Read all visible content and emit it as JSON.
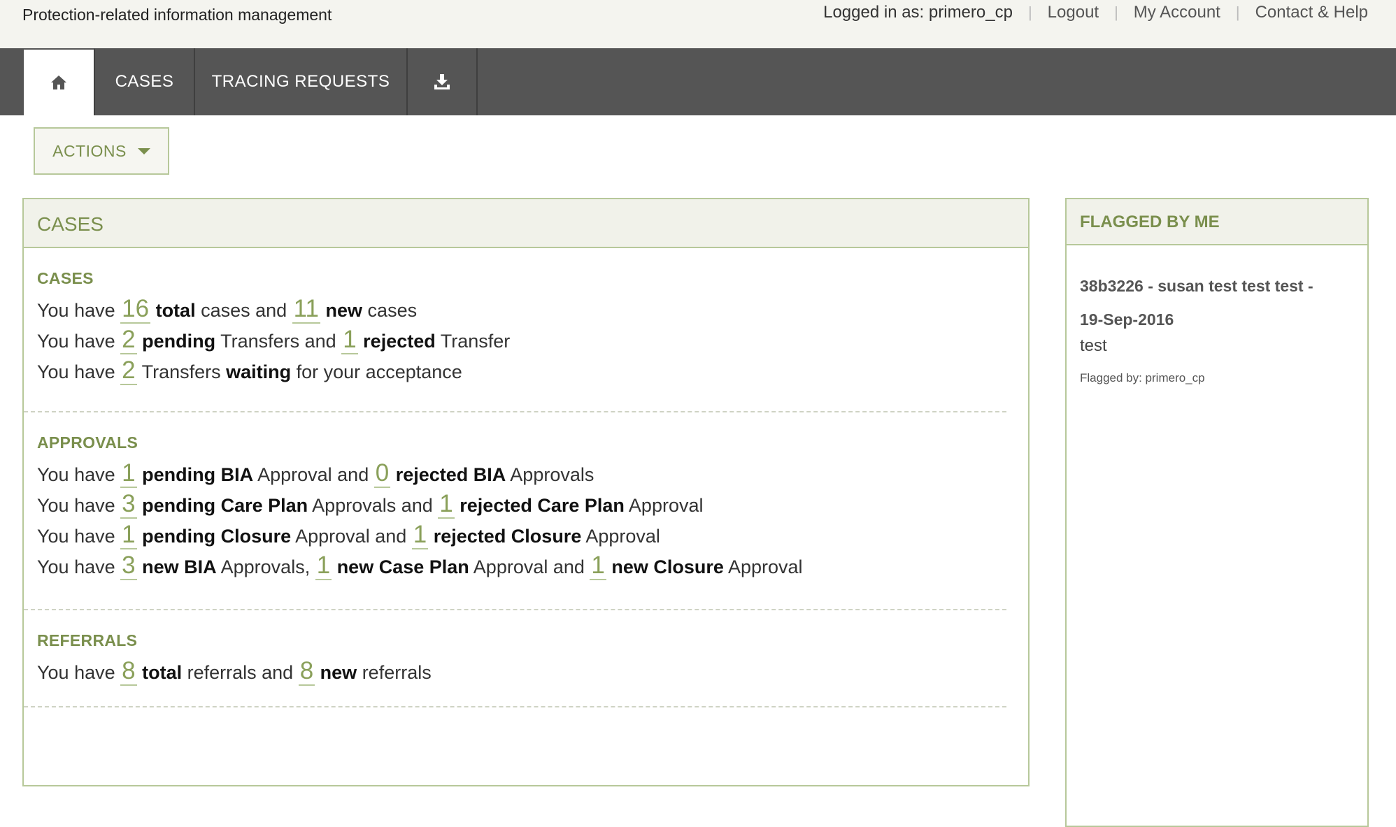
{
  "header": {
    "app_title": "Protection-related information management",
    "logged_in": "Logged in as: primero_cp",
    "logout": "Logout",
    "my_account": "My Account",
    "contact_help": "Contact & Help"
  },
  "nav": {
    "home_icon": "home-icon",
    "cases": "CASES",
    "tracing": "TRACING REQUESTS",
    "export_icon": "download-icon"
  },
  "actions": {
    "label": "ACTIONS"
  },
  "cases_panel": {
    "title": "CASES",
    "cases_section": {
      "title": "CASES",
      "lines": [
        [
          "You have ",
          "16",
          "total",
          " cases and ",
          "11",
          "new",
          " cases"
        ],
        [
          "You have ",
          "2",
          "pending",
          " Transfers and ",
          "1",
          "rejected",
          " Transfer"
        ],
        [
          "You have ",
          "2",
          " Transfers ",
          "waiting",
          " for your acceptance"
        ]
      ]
    },
    "approvals_section": {
      "title": "APPROVALS",
      "lines": [
        [
          "You have ",
          "1",
          "pending BIA",
          " Approval and ",
          "0",
          "rejected BIA",
          " Approvals"
        ],
        [
          "You have ",
          "3",
          "pending Care Plan",
          " Approvals and ",
          "1",
          "rejected Care Plan",
          " Approval"
        ],
        [
          "You have ",
          "1",
          "pending Closure",
          " Approval and ",
          "1",
          "rejected Closure",
          " Approval"
        ],
        [
          "You have ",
          "3",
          "new BIA",
          " Approvals, ",
          "1",
          "new Case Plan",
          " Approval and ",
          "1",
          "new Closure",
          " Approval"
        ]
      ]
    },
    "referrals_section": {
      "title": "REFERRALS",
      "lines": [
        [
          "You have ",
          "8",
          "total",
          " referrals and ",
          "8",
          "new",
          " referrals"
        ]
      ]
    }
  },
  "flag_panel": {
    "title": "FLAGGED BY ME",
    "item_title_line1": "38b3226 - susan test test test -",
    "item_title_line2": "19-Sep-2016",
    "item_text": "test",
    "item_flagged_by": "Flagged by: primero_cp"
  },
  "colors": {
    "accent": "#8aa05a",
    "nav_bg": "#555555",
    "panel_border": "#b7c89a"
  }
}
